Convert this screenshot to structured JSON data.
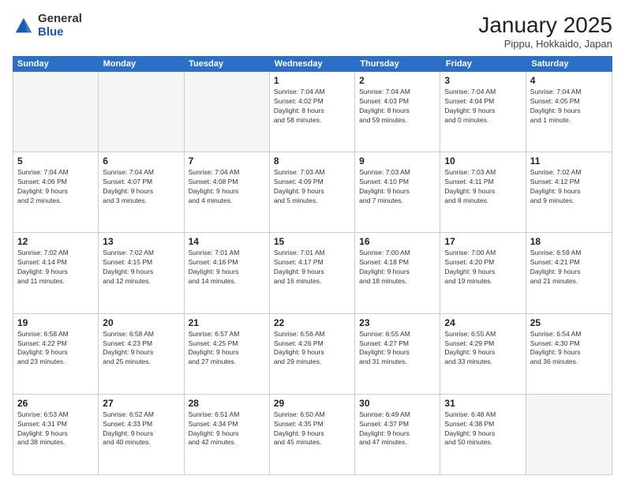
{
  "logo": {
    "general": "General",
    "blue": "Blue"
  },
  "title": "January 2025",
  "subtitle": "Pippu, Hokkaido, Japan",
  "days_header": [
    "Sunday",
    "Monday",
    "Tuesday",
    "Wednesday",
    "Thursday",
    "Friday",
    "Saturday"
  ],
  "weeks": [
    [
      {
        "num": "",
        "info": ""
      },
      {
        "num": "",
        "info": ""
      },
      {
        "num": "",
        "info": ""
      },
      {
        "num": "1",
        "info": "Sunrise: 7:04 AM\nSunset: 4:02 PM\nDaylight: 8 hours\nand 58 minutes."
      },
      {
        "num": "2",
        "info": "Sunrise: 7:04 AM\nSunset: 4:03 PM\nDaylight: 8 hours\nand 59 minutes."
      },
      {
        "num": "3",
        "info": "Sunrise: 7:04 AM\nSunset: 4:04 PM\nDaylight: 9 hours\nand 0 minutes."
      },
      {
        "num": "4",
        "info": "Sunrise: 7:04 AM\nSunset: 4:05 PM\nDaylight: 9 hours\nand 1 minute."
      }
    ],
    [
      {
        "num": "5",
        "info": "Sunrise: 7:04 AM\nSunset: 4:06 PM\nDaylight: 9 hours\nand 2 minutes."
      },
      {
        "num": "6",
        "info": "Sunrise: 7:04 AM\nSunset: 4:07 PM\nDaylight: 9 hours\nand 3 minutes."
      },
      {
        "num": "7",
        "info": "Sunrise: 7:04 AM\nSunset: 4:08 PM\nDaylight: 9 hours\nand 4 minutes."
      },
      {
        "num": "8",
        "info": "Sunrise: 7:03 AM\nSunset: 4:09 PM\nDaylight: 9 hours\nand 5 minutes."
      },
      {
        "num": "9",
        "info": "Sunrise: 7:03 AM\nSunset: 4:10 PM\nDaylight: 9 hours\nand 7 minutes."
      },
      {
        "num": "10",
        "info": "Sunrise: 7:03 AM\nSunset: 4:11 PM\nDaylight: 9 hours\nand 8 minutes."
      },
      {
        "num": "11",
        "info": "Sunrise: 7:02 AM\nSunset: 4:12 PM\nDaylight: 9 hours\nand 9 minutes."
      }
    ],
    [
      {
        "num": "12",
        "info": "Sunrise: 7:02 AM\nSunset: 4:14 PM\nDaylight: 9 hours\nand 11 minutes."
      },
      {
        "num": "13",
        "info": "Sunrise: 7:02 AM\nSunset: 4:15 PM\nDaylight: 9 hours\nand 12 minutes."
      },
      {
        "num": "14",
        "info": "Sunrise: 7:01 AM\nSunset: 4:16 PM\nDaylight: 9 hours\nand 14 minutes."
      },
      {
        "num": "15",
        "info": "Sunrise: 7:01 AM\nSunset: 4:17 PM\nDaylight: 9 hours\nand 16 minutes."
      },
      {
        "num": "16",
        "info": "Sunrise: 7:00 AM\nSunset: 4:18 PM\nDaylight: 9 hours\nand 18 minutes."
      },
      {
        "num": "17",
        "info": "Sunrise: 7:00 AM\nSunset: 4:20 PM\nDaylight: 9 hours\nand 19 minutes."
      },
      {
        "num": "18",
        "info": "Sunrise: 6:59 AM\nSunset: 4:21 PM\nDaylight: 9 hours\nand 21 minutes."
      }
    ],
    [
      {
        "num": "19",
        "info": "Sunrise: 6:58 AM\nSunset: 4:22 PM\nDaylight: 9 hours\nand 23 minutes."
      },
      {
        "num": "20",
        "info": "Sunrise: 6:58 AM\nSunset: 4:23 PM\nDaylight: 9 hours\nand 25 minutes."
      },
      {
        "num": "21",
        "info": "Sunrise: 6:57 AM\nSunset: 4:25 PM\nDaylight: 9 hours\nand 27 minutes."
      },
      {
        "num": "22",
        "info": "Sunrise: 6:56 AM\nSunset: 4:26 PM\nDaylight: 9 hours\nand 29 minutes."
      },
      {
        "num": "23",
        "info": "Sunrise: 6:55 AM\nSunset: 4:27 PM\nDaylight: 9 hours\nand 31 minutes."
      },
      {
        "num": "24",
        "info": "Sunrise: 6:55 AM\nSunset: 4:29 PM\nDaylight: 9 hours\nand 33 minutes."
      },
      {
        "num": "25",
        "info": "Sunrise: 6:54 AM\nSunset: 4:30 PM\nDaylight: 9 hours\nand 36 minutes."
      }
    ],
    [
      {
        "num": "26",
        "info": "Sunrise: 6:53 AM\nSunset: 4:31 PM\nDaylight: 9 hours\nand 38 minutes."
      },
      {
        "num": "27",
        "info": "Sunrise: 6:52 AM\nSunset: 4:33 PM\nDaylight: 9 hours\nand 40 minutes."
      },
      {
        "num": "28",
        "info": "Sunrise: 6:51 AM\nSunset: 4:34 PM\nDaylight: 9 hours\nand 42 minutes."
      },
      {
        "num": "29",
        "info": "Sunrise: 6:50 AM\nSunset: 4:35 PM\nDaylight: 9 hours\nand 45 minutes."
      },
      {
        "num": "30",
        "info": "Sunrise: 6:49 AM\nSunset: 4:37 PM\nDaylight: 9 hours\nand 47 minutes."
      },
      {
        "num": "31",
        "info": "Sunrise: 6:48 AM\nSunset: 4:38 PM\nDaylight: 9 hours\nand 50 minutes."
      },
      {
        "num": "",
        "info": ""
      }
    ]
  ]
}
